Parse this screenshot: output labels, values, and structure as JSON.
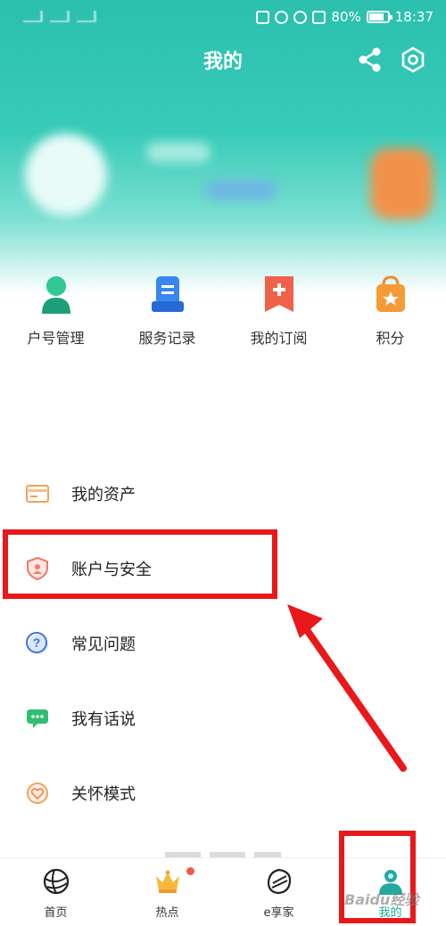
{
  "status_bar": {
    "battery": "80%",
    "time": "18:37"
  },
  "header": {
    "title": "我的"
  },
  "quick_actions": [
    {
      "label": "户号管理",
      "icon": "user-icon"
    },
    {
      "label": "服务记录",
      "icon": "record-icon"
    },
    {
      "label": "我的订阅",
      "icon": "subscribe-icon"
    },
    {
      "label": "积分",
      "icon": "points-bag-icon"
    }
  ],
  "menu": [
    {
      "label": "我的资产",
      "icon": "card-icon"
    },
    {
      "label": "账户与安全",
      "icon": "shield-icon"
    },
    {
      "label": "常见问题",
      "icon": "question-icon"
    },
    {
      "label": "我有话说",
      "icon": "chat-icon"
    },
    {
      "label": "关怀模式",
      "icon": "care-icon"
    }
  ],
  "tabbar": {
    "tabs": [
      {
        "label": "首页",
        "icon": "globe-icon"
      },
      {
        "label": "热点",
        "icon": "crown-icon"
      },
      {
        "label": "e享家",
        "icon": "e-leaf-icon"
      },
      {
        "label": "我的",
        "icon": "profile-icon"
      }
    ],
    "active_index": 3
  },
  "watermark": "Baidu经验",
  "colors": {
    "accent": "#2bbfae",
    "highlight": "#e8181b",
    "badge": "#f25b4a"
  }
}
